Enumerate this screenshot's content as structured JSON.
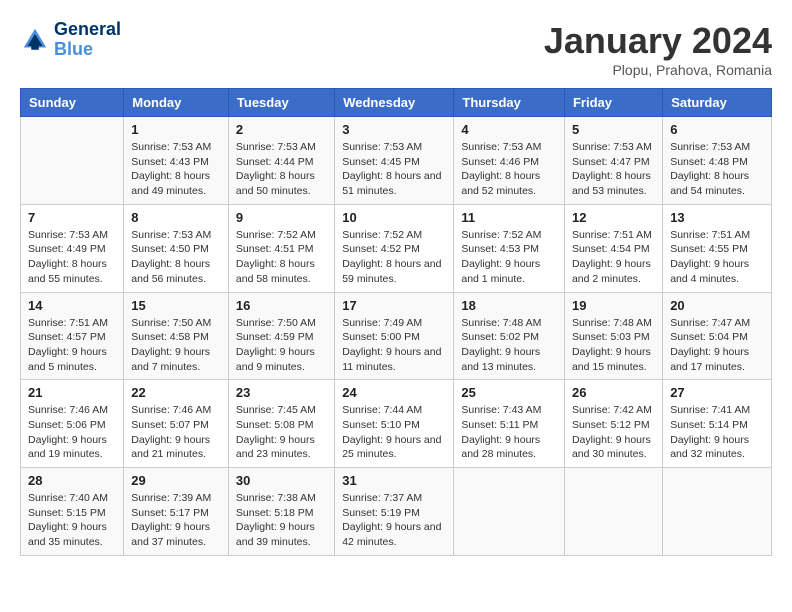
{
  "logo": {
    "text_general": "General",
    "text_blue": "Blue"
  },
  "title": "January 2024",
  "location": "Plopu, Prahova, Romania",
  "days_of_week": [
    "Sunday",
    "Monday",
    "Tuesday",
    "Wednesday",
    "Thursday",
    "Friday",
    "Saturday"
  ],
  "weeks": [
    [
      {
        "day": "",
        "sunrise": "",
        "sunset": "",
        "daylight": ""
      },
      {
        "day": "1",
        "sunrise": "Sunrise: 7:53 AM",
        "sunset": "Sunset: 4:43 PM",
        "daylight": "Daylight: 8 hours and 49 minutes."
      },
      {
        "day": "2",
        "sunrise": "Sunrise: 7:53 AM",
        "sunset": "Sunset: 4:44 PM",
        "daylight": "Daylight: 8 hours and 50 minutes."
      },
      {
        "day": "3",
        "sunrise": "Sunrise: 7:53 AM",
        "sunset": "Sunset: 4:45 PM",
        "daylight": "Daylight: 8 hours and 51 minutes."
      },
      {
        "day": "4",
        "sunrise": "Sunrise: 7:53 AM",
        "sunset": "Sunset: 4:46 PM",
        "daylight": "Daylight: 8 hours and 52 minutes."
      },
      {
        "day": "5",
        "sunrise": "Sunrise: 7:53 AM",
        "sunset": "Sunset: 4:47 PM",
        "daylight": "Daylight: 8 hours and 53 minutes."
      },
      {
        "day": "6",
        "sunrise": "Sunrise: 7:53 AM",
        "sunset": "Sunset: 4:48 PM",
        "daylight": "Daylight: 8 hours and 54 minutes."
      }
    ],
    [
      {
        "day": "7",
        "sunrise": "Sunrise: 7:53 AM",
        "sunset": "Sunset: 4:49 PM",
        "daylight": "Daylight: 8 hours and 55 minutes."
      },
      {
        "day": "8",
        "sunrise": "Sunrise: 7:53 AM",
        "sunset": "Sunset: 4:50 PM",
        "daylight": "Daylight: 8 hours and 56 minutes."
      },
      {
        "day": "9",
        "sunrise": "Sunrise: 7:52 AM",
        "sunset": "Sunset: 4:51 PM",
        "daylight": "Daylight: 8 hours and 58 minutes."
      },
      {
        "day": "10",
        "sunrise": "Sunrise: 7:52 AM",
        "sunset": "Sunset: 4:52 PM",
        "daylight": "Daylight: 8 hours and 59 minutes."
      },
      {
        "day": "11",
        "sunrise": "Sunrise: 7:52 AM",
        "sunset": "Sunset: 4:53 PM",
        "daylight": "Daylight: 9 hours and 1 minute."
      },
      {
        "day": "12",
        "sunrise": "Sunrise: 7:51 AM",
        "sunset": "Sunset: 4:54 PM",
        "daylight": "Daylight: 9 hours and 2 minutes."
      },
      {
        "day": "13",
        "sunrise": "Sunrise: 7:51 AM",
        "sunset": "Sunset: 4:55 PM",
        "daylight": "Daylight: 9 hours and 4 minutes."
      }
    ],
    [
      {
        "day": "14",
        "sunrise": "Sunrise: 7:51 AM",
        "sunset": "Sunset: 4:57 PM",
        "daylight": "Daylight: 9 hours and 5 minutes."
      },
      {
        "day": "15",
        "sunrise": "Sunrise: 7:50 AM",
        "sunset": "Sunset: 4:58 PM",
        "daylight": "Daylight: 9 hours and 7 minutes."
      },
      {
        "day": "16",
        "sunrise": "Sunrise: 7:50 AM",
        "sunset": "Sunset: 4:59 PM",
        "daylight": "Daylight: 9 hours and 9 minutes."
      },
      {
        "day": "17",
        "sunrise": "Sunrise: 7:49 AM",
        "sunset": "Sunset: 5:00 PM",
        "daylight": "Daylight: 9 hours and 11 minutes."
      },
      {
        "day": "18",
        "sunrise": "Sunrise: 7:48 AM",
        "sunset": "Sunset: 5:02 PM",
        "daylight": "Daylight: 9 hours and 13 minutes."
      },
      {
        "day": "19",
        "sunrise": "Sunrise: 7:48 AM",
        "sunset": "Sunset: 5:03 PM",
        "daylight": "Daylight: 9 hours and 15 minutes."
      },
      {
        "day": "20",
        "sunrise": "Sunrise: 7:47 AM",
        "sunset": "Sunset: 5:04 PM",
        "daylight": "Daylight: 9 hours and 17 minutes."
      }
    ],
    [
      {
        "day": "21",
        "sunrise": "Sunrise: 7:46 AM",
        "sunset": "Sunset: 5:06 PM",
        "daylight": "Daylight: 9 hours and 19 minutes."
      },
      {
        "day": "22",
        "sunrise": "Sunrise: 7:46 AM",
        "sunset": "Sunset: 5:07 PM",
        "daylight": "Daylight: 9 hours and 21 minutes."
      },
      {
        "day": "23",
        "sunrise": "Sunrise: 7:45 AM",
        "sunset": "Sunset: 5:08 PM",
        "daylight": "Daylight: 9 hours and 23 minutes."
      },
      {
        "day": "24",
        "sunrise": "Sunrise: 7:44 AM",
        "sunset": "Sunset: 5:10 PM",
        "daylight": "Daylight: 9 hours and 25 minutes."
      },
      {
        "day": "25",
        "sunrise": "Sunrise: 7:43 AM",
        "sunset": "Sunset: 5:11 PM",
        "daylight": "Daylight: 9 hours and 28 minutes."
      },
      {
        "day": "26",
        "sunrise": "Sunrise: 7:42 AM",
        "sunset": "Sunset: 5:12 PM",
        "daylight": "Daylight: 9 hours and 30 minutes."
      },
      {
        "day": "27",
        "sunrise": "Sunrise: 7:41 AM",
        "sunset": "Sunset: 5:14 PM",
        "daylight": "Daylight: 9 hours and 32 minutes."
      }
    ],
    [
      {
        "day": "28",
        "sunrise": "Sunrise: 7:40 AM",
        "sunset": "Sunset: 5:15 PM",
        "daylight": "Daylight: 9 hours and 35 minutes."
      },
      {
        "day": "29",
        "sunrise": "Sunrise: 7:39 AM",
        "sunset": "Sunset: 5:17 PM",
        "daylight": "Daylight: 9 hours and 37 minutes."
      },
      {
        "day": "30",
        "sunrise": "Sunrise: 7:38 AM",
        "sunset": "Sunset: 5:18 PM",
        "daylight": "Daylight: 9 hours and 39 minutes."
      },
      {
        "day": "31",
        "sunrise": "Sunrise: 7:37 AM",
        "sunset": "Sunset: 5:19 PM",
        "daylight": "Daylight: 9 hours and 42 minutes."
      },
      {
        "day": "",
        "sunrise": "",
        "sunset": "",
        "daylight": ""
      },
      {
        "day": "",
        "sunrise": "",
        "sunset": "",
        "daylight": ""
      },
      {
        "day": "",
        "sunrise": "",
        "sunset": "",
        "daylight": ""
      }
    ]
  ]
}
